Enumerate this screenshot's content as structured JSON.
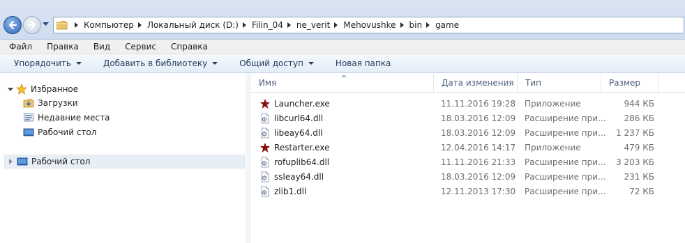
{
  "address_bar": {
    "crumbs": [
      "Компьютер",
      "Локальный диск (D:)",
      "Filin_04",
      "ne_verit",
      "Mehovushke",
      "bin",
      "game"
    ]
  },
  "menu": [
    "Файл",
    "Правка",
    "Вид",
    "Сервис",
    "Справка"
  ],
  "toolbar": {
    "organize": "Упорядочить",
    "add_to_library": "Добавить в библиотеку",
    "share": "Общий доступ",
    "new_folder": "Новая папка"
  },
  "nav": {
    "favorites_label": "Избранное",
    "favorites_items": [
      "Загрузки",
      "Недавние места",
      "Рабочий стол"
    ],
    "desktop_label": "Рабочий стол"
  },
  "columns": {
    "name": "Имя",
    "date": "Дата изменения",
    "type": "Тип",
    "size": "Размер"
  },
  "files": [
    {
      "name": "Launcher.exe",
      "date": "11.11.2016 19:28",
      "type": "Приложение",
      "size": "944 КБ",
      "icon": "star-app-icon"
    },
    {
      "name": "libcurl64.dll",
      "date": "18.03.2016 12:09",
      "type": "Расширение при...",
      "size": "286 КБ",
      "icon": "dll-file-icon"
    },
    {
      "name": "libeay64.dll",
      "date": "18.03.2016 12:09",
      "type": "Расширение при...",
      "size": "1 237 КБ",
      "icon": "dll-file-icon"
    },
    {
      "name": "Restarter.exe",
      "date": "12.04.2016 14:17",
      "type": "Приложение",
      "size": "479 КБ",
      "icon": "star-app-icon"
    },
    {
      "name": "rofuplib64.dll",
      "date": "11.11.2016 21:33",
      "type": "Расширение при...",
      "size": "3 203 КБ",
      "icon": "dll-file-icon"
    },
    {
      "name": "ssleay64.dll",
      "date": "18.03.2016 12:09",
      "type": "Расширение при...",
      "size": "231 КБ",
      "icon": "dll-file-icon"
    },
    {
      "name": "zlib1.dll",
      "date": "12.11.2013 17:30",
      "type": "Расширение при...",
      "size": "72 КБ",
      "icon": "dll-file-icon"
    }
  ],
  "colors": {
    "app_icon_star": "#8b1010",
    "selection": "#e8eef6",
    "header_text": "#4c607a"
  }
}
